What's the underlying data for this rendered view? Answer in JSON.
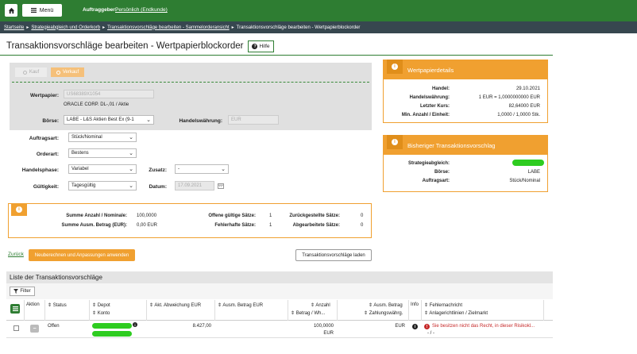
{
  "header": {
    "menu_label": "Menü",
    "auftraggeber_label": "Auftraggeber:",
    "auftraggeber_value": "Persönlich (Endkunde)"
  },
  "breadcrumb": [
    "Startseite",
    "Strategieabgleich und Orderkorb",
    "Transaktionsvorschläge bearbeiten - Sammelorderansicht",
    "Transaktionsvorschläge bearbeiten - Wertpapierblockorder"
  ],
  "page": {
    "title": "Transaktionsvorschläge bearbeiten - Wertpapierblockorder",
    "help_label": "Hilfe"
  },
  "order": {
    "tab_kauf": "Kauf",
    "tab_verkauf": "Verkauf",
    "wertpapier_label": "Wertpapier:",
    "wertpapier_value": "US68389X1054",
    "wertpapier_name": "ORACLE CORP. DL-,01 / Aktie",
    "boerse_label": "Börse:",
    "boerse_value": "LABE - L&S Aktien Best Ex (9-1",
    "handelswaehrung_label": "Handelswährung:",
    "handelswaehrung_value": "EUR",
    "auftragsart_label": "Auftragsart:",
    "auftragsart_value": "Stück/Nominal",
    "orderart_label": "Orderart:",
    "orderart_value": "Bestens",
    "handelsphase_label": "Handelsphase:",
    "handelsphase_value": "Variabel",
    "zusatz_label": "Zusatz:",
    "zusatz_value": "-",
    "gueltigkeit_label": "Gültigkeit:",
    "gueltigkeit_value": "Tagesgültig",
    "datum_label": "Datum:",
    "datum_value": "17.09.2021"
  },
  "summary": {
    "summe_anzahl_label": "Summe Anzahl / Nominale:",
    "summe_anzahl_value": "100,0000",
    "summe_betrag_label": "Summe Ausm. Betrag (EUR):",
    "summe_betrag_value": "0,00 EUR",
    "offene_label": "Offene gültige Sätze:",
    "offene_value": "1",
    "fehlerhafte_label": "Fehlerhafte Sätze:",
    "fehlerhafte_value": "1",
    "zurueck_label": "Zurückgestellte Sätze:",
    "zurueck_value": "0",
    "abgearbeitet_label": "Abgearbeitete Sätze:",
    "abgearbeitet_value": "0"
  },
  "wertpapierdetails": {
    "title": "Wertpapierdetails",
    "rows": [
      {
        "label": "Handel:",
        "value": "29.10.2021"
      },
      {
        "label": "Handelswährung:",
        "value": "1 EUR = 1,0000000000 EUR"
      },
      {
        "label": "Letzter Kurs:",
        "value": "82,64000 EUR"
      },
      {
        "label": "Min. Anzahl / Einheit:",
        "value": "1,0000 / 1,0000 Stk."
      }
    ]
  },
  "bisheriger": {
    "title": "Bisheriger Transaktionsvorschlag",
    "strategie_label": "Strategieabgleich:",
    "boerse_label": "Börse:",
    "boerse_value": "LABE",
    "auftragsart_label": "Auftragsart:",
    "auftragsart_value": "Stück/Nominal"
  },
  "actions": {
    "zurueck": "Zurück",
    "neuberechnen": "Neuberechnen und Anpassungen anwenden",
    "laden": "Transaktionsvorschläge laden"
  },
  "list": {
    "title": "Liste der Transaktionsvorschläge",
    "filter_label": "Filter",
    "headers": {
      "aktion": "Aktion",
      "status": "Status",
      "depot": "Depot",
      "konto": "Konto",
      "abweichung": "Akt. Abweichung EUR",
      "ausm_betrag": "Ausm. Betrag EUR",
      "anzahl": "Anzahl",
      "betrag_wh": "Betrag / Wh...",
      "ausm_betrag2": "Ausm. Betrag",
      "zahlungswaehrung": "Zahlungswährg.",
      "info": "Info",
      "fehlernachricht": "Fehlernachricht",
      "anlagerichtlinien": "Anlagerichtlinien / Zielmarkt"
    },
    "rows": [
      {
        "status": "Offen",
        "abweichung": "8.427,00",
        "anzahl": "100,0000",
        "anzahl_unit": "EUR",
        "zahlungswaehrung": "EUR",
        "fehlernachricht": "Sie besitzen nicht das Recht, in dieser Risikokl...",
        "zielmarkt": "- / -"
      }
    ]
  },
  "colors": {
    "primary_green": "#2e7d32",
    "accent_orange": "#f0a030",
    "breadcrumb_bg": "#37474f",
    "masked_green": "#2ecc20",
    "error_red": "#c62828"
  }
}
